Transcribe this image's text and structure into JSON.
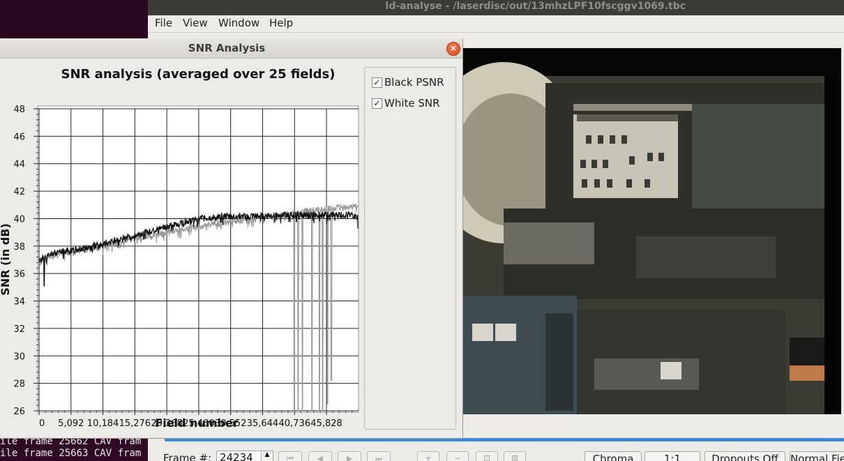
{
  "window": {
    "title": "ld-analyse - /laserdisc/out/13mhzLPF10fscggv1069.tbc"
  },
  "menu": [
    "File",
    "View",
    "Window",
    "Help"
  ],
  "terminal": {
    "lines": [
      "ile frame 25662 CAV fram",
      "ile frame 25663 CAV fram"
    ]
  },
  "dialog": {
    "title": "SNR Analysis",
    "legend": [
      {
        "label": "Black PSNR",
        "checked": true,
        "check_glyph": "✓"
      },
      {
        "label": "White SNR",
        "checked": true,
        "check_glyph": "✓"
      }
    ]
  },
  "chart_data": {
    "type": "line",
    "title": "SNR analysis (averaged over 25 fields)",
    "xlabel": "Field number",
    "ylabel": "SNR (in dB)",
    "xlim": [
      0,
      50940
    ],
    "ylim": [
      26,
      48
    ],
    "x_ticks": [
      0,
      5092,
      10184,
      15276,
      20368,
      25460,
      30552,
      35644,
      40736,
      45828
    ],
    "x_tick_labels": [
      "0",
      "5,092",
      "10,184",
      "15,276",
      "20,368",
      "25,460",
      "30,552",
      "35,644",
      "40,736",
      "45,828"
    ],
    "y_ticks": [
      26,
      28,
      30,
      32,
      34,
      36,
      38,
      40,
      42,
      44,
      46,
      48
    ],
    "y_tick_labels": [
      "26",
      "28",
      "30",
      "32",
      "34",
      "36",
      "38",
      "40",
      "42",
      "44",
      "46",
      "48"
    ],
    "grid": true,
    "series": [
      {
        "name": "Black PSNR",
        "color": "#111111",
        "x": [
          0,
          1000,
          2000,
          3000,
          5000,
          7000,
          10000,
          12500,
          15000,
          17500,
          20000,
          22500,
          25000,
          27500,
          30000,
          32500,
          35000,
          37500,
          40000,
          42500,
          45000,
          47500,
          50000,
          50900
        ],
        "y": [
          37.0,
          37.3,
          37.5,
          37.6,
          37.7,
          37.9,
          38.2,
          38.5,
          38.8,
          39.1,
          39.4,
          39.7,
          40.0,
          40.1,
          40.2,
          40.2,
          40.2,
          40.3,
          40.3,
          40.3,
          40.3,
          40.3,
          40.3,
          40.1
        ]
      },
      {
        "name": "White SNR",
        "color": "#999999",
        "x": [
          0,
          1000,
          2000,
          3000,
          5000,
          7000,
          10000,
          12500,
          15000,
          17500,
          20000,
          22500,
          25000,
          27500,
          30000,
          32500,
          35000,
          37500,
          40000,
          42500,
          45000,
          47500,
          50000,
          50900
        ],
        "y": [
          36.8,
          37.1,
          37.3,
          37.5,
          37.6,
          37.8,
          38.0,
          38.3,
          38.6,
          38.8,
          39.0,
          39.2,
          39.4,
          39.6,
          39.8,
          39.9,
          40.1,
          40.2,
          40.4,
          40.6,
          40.7,
          40.8,
          40.9,
          41.0
        ]
      }
    ],
    "dips": [
      {
        "series": "White SNR",
        "x": 40700,
        "y": 26.0
      },
      {
        "series": "White SNR",
        "x": 41300,
        "y": 26.0
      },
      {
        "series": "White SNR",
        "x": 42000,
        "y": 26.0
      },
      {
        "series": "White SNR",
        "x": 43500,
        "y": 26.0
      },
      {
        "series": "White SNR",
        "x": 44700,
        "y": 26.0
      },
      {
        "series": "White SNR",
        "x": 45200,
        "y": 26.0
      },
      {
        "series": "White SNR",
        "x": 46000,
        "y": 26.5
      },
      {
        "series": "White SNR",
        "x": 46600,
        "y": 28.2
      },
      {
        "series": "Black PSNR",
        "x": 800,
        "y": 35.1
      },
      {
        "series": "Black PSNR",
        "x": 50900,
        "y": 39.3
      }
    ]
  },
  "bottom": {
    "frame_label": "Frame #:",
    "frame_value": "24234",
    "nav_buttons": [
      "⏮",
      "◀",
      "▶",
      "⏭"
    ],
    "zoom_buttons": [
      "+",
      "−",
      "⊡",
      "⊞"
    ],
    "chroma_label": "Chroma",
    "ratio_label": "1:1",
    "dropouts_label": "Dropouts Off",
    "field_label": "Normal Fie"
  }
}
